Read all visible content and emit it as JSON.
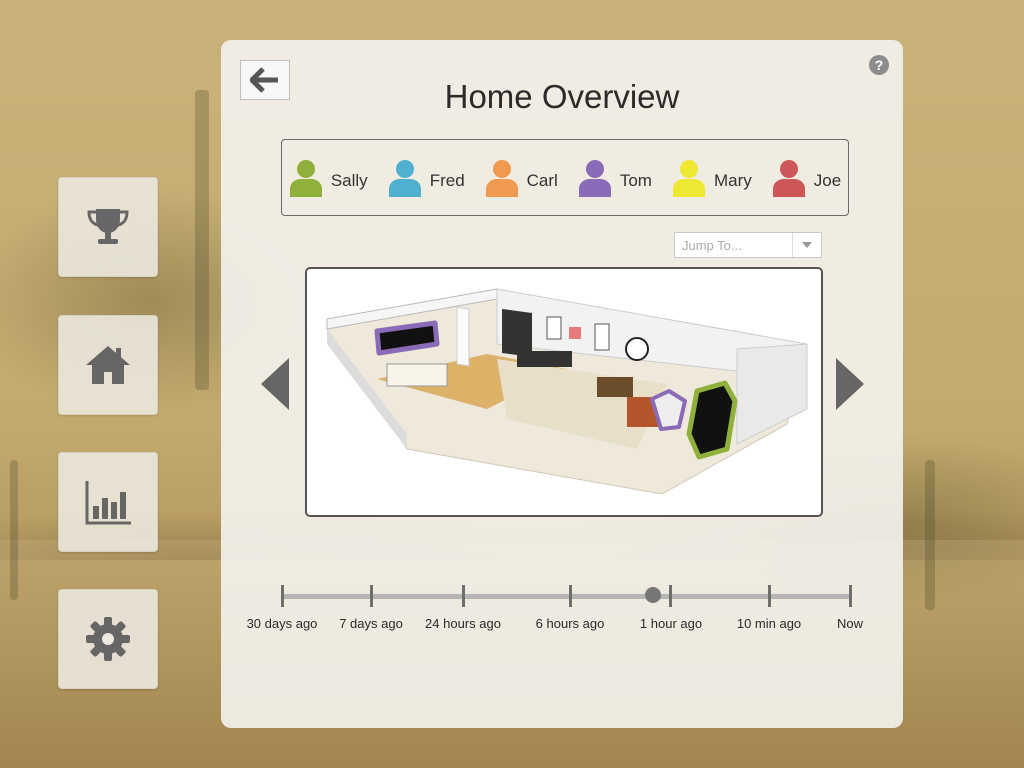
{
  "colors": {
    "user_colors": {
      "Sally": "#8fb03a",
      "Fred": "#4fb0cf",
      "Carl": "#f09a50",
      "Tom": "#8a6bb7",
      "Mary": "#efe833",
      "Joe": "#cd5656"
    },
    "icon_grey": "#666666"
  },
  "sidebar": {
    "items": [
      {
        "name": "trophy",
        "icon": "trophy-icon"
      },
      {
        "name": "home",
        "icon": "home-icon"
      },
      {
        "name": "stats",
        "icon": "bar-chart-icon"
      },
      {
        "name": "settings",
        "icon": "gear-icon"
      }
    ]
  },
  "header": {
    "back_icon": "arrow-left-icon",
    "help_label": "?",
    "title": "Home Overview"
  },
  "users": [
    {
      "name": "Sally"
    },
    {
      "name": "Fred"
    },
    {
      "name": "Carl"
    },
    {
      "name": "Tom"
    },
    {
      "name": "Mary"
    },
    {
      "name": "Joe"
    }
  ],
  "jump": {
    "placeholder": "Jump To..."
  },
  "viewer": {
    "image_alt": "3D floorplan of the home"
  },
  "timeline": {
    "labels": [
      "30 days ago",
      "7 days ago",
      "24 hours ago",
      "6 hours ago",
      "1 hour ago",
      "10 min ago",
      "Now"
    ]
  }
}
